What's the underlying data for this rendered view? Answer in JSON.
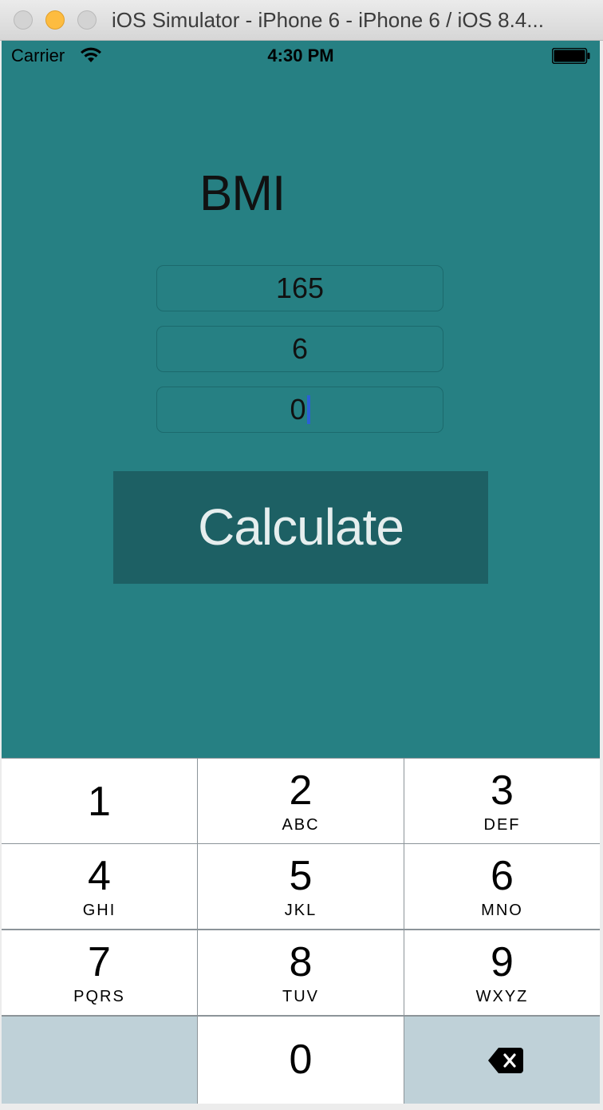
{
  "window": {
    "title": "iOS Simulator - iPhone 6 - iPhone 6 / iOS 8.4..."
  },
  "status_bar": {
    "carrier": "Carrier",
    "time": "4:30 PM"
  },
  "app": {
    "title": "BMI",
    "fields": [
      {
        "value": "165"
      },
      {
        "value": "6"
      },
      {
        "value": "0"
      }
    ],
    "calculate_label": "Calculate"
  },
  "keypad": {
    "keys": [
      {
        "num": "1",
        "letters": ""
      },
      {
        "num": "2",
        "letters": "ABC"
      },
      {
        "num": "3",
        "letters": "DEF"
      },
      {
        "num": "4",
        "letters": "GHI"
      },
      {
        "num": "5",
        "letters": "JKL"
      },
      {
        "num": "6",
        "letters": "MNO"
      },
      {
        "num": "7",
        "letters": "PQRS"
      },
      {
        "num": "8",
        "letters": "TUV"
      },
      {
        "num": "9",
        "letters": "WXYZ"
      },
      {
        "num": "0",
        "letters": ""
      }
    ],
    "delete_icon": "backspace-icon"
  },
  "colors": {
    "app_background": "#268083",
    "button_background": "#1d6064",
    "caret": "#2b5fd6",
    "keypad_gray_key": "#bfd1d8"
  }
}
